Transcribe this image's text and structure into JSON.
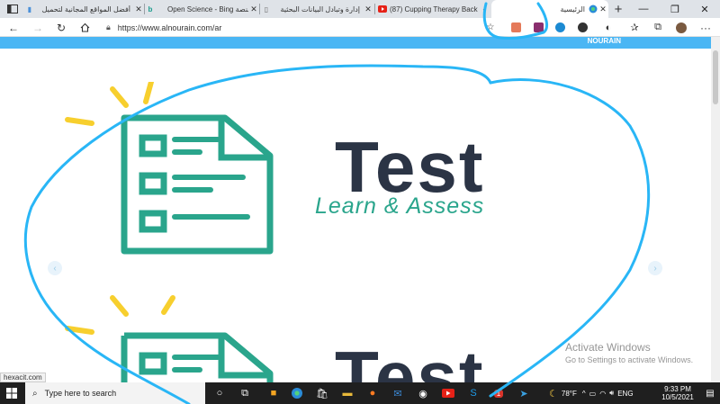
{
  "browser": {
    "tabs": [
      {
        "title": "أفضل المواقع المجانية لتحميل",
        "icon": "page-icon",
        "active": false
      },
      {
        "title": "Open Science - Bing منصة",
        "icon": "bing-icon",
        "active": false
      },
      {
        "title": "إدارة وتبادل البيانات البحثية",
        "icon": "document-icon",
        "active": false
      },
      {
        "title": "(87) Cupping Therapy Back",
        "icon": "youtube-icon",
        "active": false
      },
      {
        "title": "الرئيسية",
        "icon": "edge-icon",
        "active": true
      }
    ],
    "new_tab_label": "+",
    "address_url": "https://www.alnourain.com/ar"
  },
  "site": {
    "brand": "NOURAIN",
    "slides": [
      {
        "headline": "Test",
        "tagline": "Learn & Assess"
      },
      {
        "headline": "Test",
        "tagline": ""
      }
    ],
    "prev_arrow": "‹",
    "next_arrow": "›"
  },
  "windows": {
    "activate_title": "Activate Windows",
    "activate_sub": "Go to Settings to activate Windows."
  },
  "status_bar_url": "hexacit.com",
  "taskbar": {
    "search_placeholder": "Type here to search",
    "weather": "78°F",
    "language": "ENG",
    "time": "9:33 PM",
    "date": "10/5/2021",
    "mail_badge": "1"
  },
  "colors": {
    "tab_strip": "#dfe3e8",
    "site_header": "#4ab6f4",
    "brand_teal": "#2aa58c",
    "headline_navy": "#2b3445",
    "bulb_yellow": "#f7cf2e",
    "annotation_blue": "#29b6f6",
    "taskbar": "#1f1f1f"
  }
}
